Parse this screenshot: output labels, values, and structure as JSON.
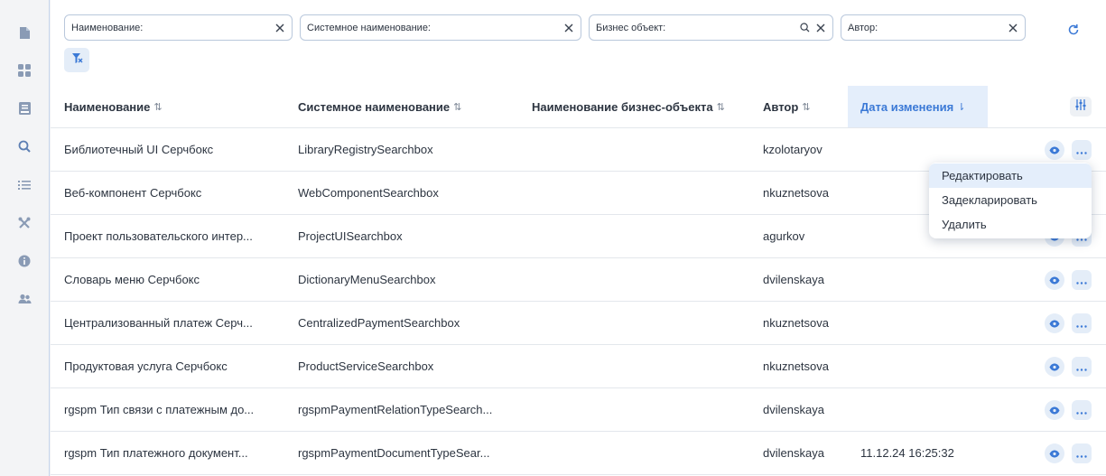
{
  "sidebar": {
    "items": [
      {
        "icon": "document-icon"
      },
      {
        "icon": "dashboard-icon"
      },
      {
        "icon": "book-icon"
      },
      {
        "icon": "search-icon"
      },
      {
        "icon": "list-icon"
      },
      {
        "icon": "tools-icon"
      },
      {
        "icon": "info-icon"
      },
      {
        "icon": "users-icon"
      }
    ]
  },
  "filters": {
    "name": "Наименование:",
    "system_name": "Системное наименование:",
    "business_object": "Бизнес объект:",
    "author": "Автор:"
  },
  "table": {
    "columns": {
      "name": "Наименование",
      "system_name": "Системное наименование",
      "business_object_name": "Наименование бизнес-объекта",
      "author": "Автор",
      "modified": "Дата изменения"
    },
    "sort_icon": "⇅",
    "active_sort_icon": "⇂",
    "rows": [
      {
        "name": "Библиотечный UI Серчбокс",
        "system_name": "LibraryRegistrySearchbox",
        "business_object": "",
        "author": "kzolotaryov",
        "modified": ""
      },
      {
        "name": "Веб-компонент Серчбокс",
        "system_name": "WebComponentSearchbox",
        "business_object": "",
        "author": "nkuznetsova",
        "modified": ""
      },
      {
        "name": "Проект пользовательского интер...",
        "system_name": "ProjectUISearchbox",
        "business_object": "",
        "author": "agurkov",
        "modified": ""
      },
      {
        "name": "Словарь меню Серчбокс",
        "system_name": "DictionaryMenuSearchbox",
        "business_object": "",
        "author": "dvilenskaya",
        "modified": ""
      },
      {
        "name": "Централизованный платеж Серч...",
        "system_name": "CentralizedPaymentSearchbox",
        "business_object": "",
        "author": "nkuznetsova",
        "modified": ""
      },
      {
        "name": "Продуктовая услуга Серчбокс",
        "system_name": "ProductServiceSearchbox",
        "business_object": "",
        "author": "nkuznetsova",
        "modified": ""
      },
      {
        "name": "rgspm Тип связи с платежным до...",
        "system_name": "rgspmPaymentRelationTypeSearch...",
        "business_object": "",
        "author": "dvilenskaya",
        "modified": ""
      },
      {
        "name": "rgspm Тип платежного документ...",
        "system_name": "rgspmPaymentDocumentTypeSear...",
        "business_object": "",
        "author": "dvilenskaya",
        "modified": "11.12.24 16:25:32"
      }
    ]
  },
  "context_menu": {
    "items": [
      "Редактировать",
      "Задекларировать",
      "Удалить"
    ],
    "highlighted": "Редактировать"
  },
  "colors": {
    "accent": "#3b79d6",
    "accent_bg": "#e4eefb",
    "border": "#b9c8dc"
  }
}
